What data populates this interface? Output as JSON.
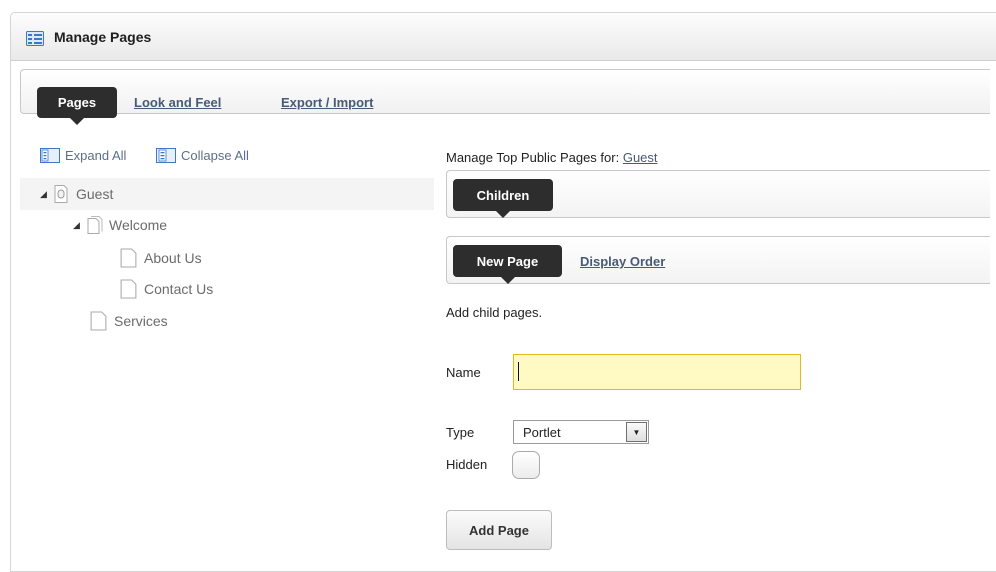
{
  "portlet": {
    "title": "Manage Pages"
  },
  "tabs": {
    "active": "Pages",
    "items": [
      "Look and Feel",
      "Export / Import"
    ]
  },
  "tree_toolbar": {
    "expand_all": "Expand All",
    "collapse_all": "Collapse All"
  },
  "tree": {
    "root": "Guest",
    "welcome": "Welcome",
    "about": "About Us",
    "contact": "Contact Us",
    "services": "Services"
  },
  "manage": {
    "label": "Manage Top Public Pages for:",
    "link": "Guest"
  },
  "children_tab": "Children",
  "subtabs": {
    "active": "New Page",
    "other": "Display Order"
  },
  "form": {
    "intro": "Add child pages.",
    "name_label": "Name",
    "name_value": "",
    "type_label": "Type",
    "type_value": "Portlet",
    "hidden_label": "Hidden",
    "hidden_checked": false,
    "submit": "Add Page"
  },
  "colors": {
    "accent": "#485a76",
    "input_highlight": "#fff9c4",
    "pill": "#2d2d2d"
  }
}
